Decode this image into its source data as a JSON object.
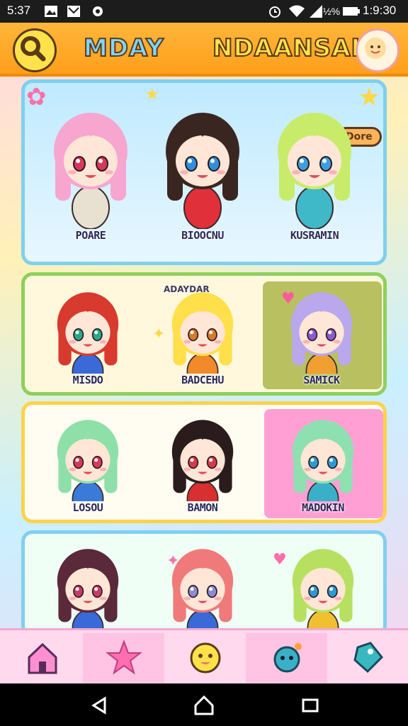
{
  "status_bar": {
    "time_left": "5:37",
    "time_right": "1:9:30",
    "battery": "½%"
  },
  "header": {
    "title_left": "MDAY",
    "title_right": "NDAANSAI"
  },
  "panel1": {
    "characters": [
      {
        "name": "POARE",
        "hair": "#f7a6d0",
        "eyes": "#d9365a",
        "outfit": "#e8e0d0"
      },
      {
        "name": "BIOOCNU",
        "hair": "#3a2620",
        "eyes": "#2f8ee0",
        "outfit": "#e0303a"
      },
      {
        "name": "KUSRAMIN",
        "hair": "#c8ec6a",
        "eyes": "#3a9fe0",
        "outfit": "#3fb8c8"
      }
    ],
    "speech": "Dore"
  },
  "panel2": {
    "characters": [
      {
        "name": "MISDO",
        "hair": "#d83a2e",
        "eyes": "#28a88a",
        "outfit": "#3a6ad8"
      },
      {
        "name": "BADCEHU",
        "hair": "#ffe04a",
        "eyes": "#d87a2a",
        "outfit": "#f08a2a"
      },
      {
        "name": "SAMICK",
        "hair": "#b9a8ec",
        "eyes": "#8a5ad8",
        "outfit": "#f0a030"
      }
    ],
    "sign": "ADAYDAR"
  },
  "panel3": {
    "characters": [
      {
        "name": "LOSOU",
        "hair": "#8fe0a8",
        "eyes": "#d83a5a",
        "outfit": "#3a7ad8"
      },
      {
        "name": "BAMON",
        "hair": "#2a1c1c",
        "eyes": "#d83a4a",
        "outfit": "#d83030"
      },
      {
        "name": "MADOKIN",
        "hair": "#8fe0b0",
        "eyes": "#2a9ad8",
        "outfit": "#3ab0c8"
      }
    ]
  },
  "panel4": {
    "characters": [
      {
        "name": "",
        "hair": "#5a2a3a",
        "eyes": "#c83a6a",
        "outfit": "#3a6ad8"
      },
      {
        "name": "",
        "hair": "#f07a7a",
        "eyes": "#8a8ad8",
        "outfit": "#3a6ad8"
      },
      {
        "name": "",
        "hair": "#b8e060",
        "eyes": "#2a9ad8",
        "outfit": "#f0c030"
      }
    ]
  },
  "bottom_nav": [
    "home-icon",
    "star-icon",
    "mascot-icon",
    "creature-icon",
    "bookmark-icon"
  ],
  "colors": {
    "header": "#ffa726",
    "panel1_border": "#7fd0f0",
    "panel2_border": "#8ed05a",
    "panel3_border": "#ffd24a",
    "panel4_border": "#7fd0f0"
  }
}
